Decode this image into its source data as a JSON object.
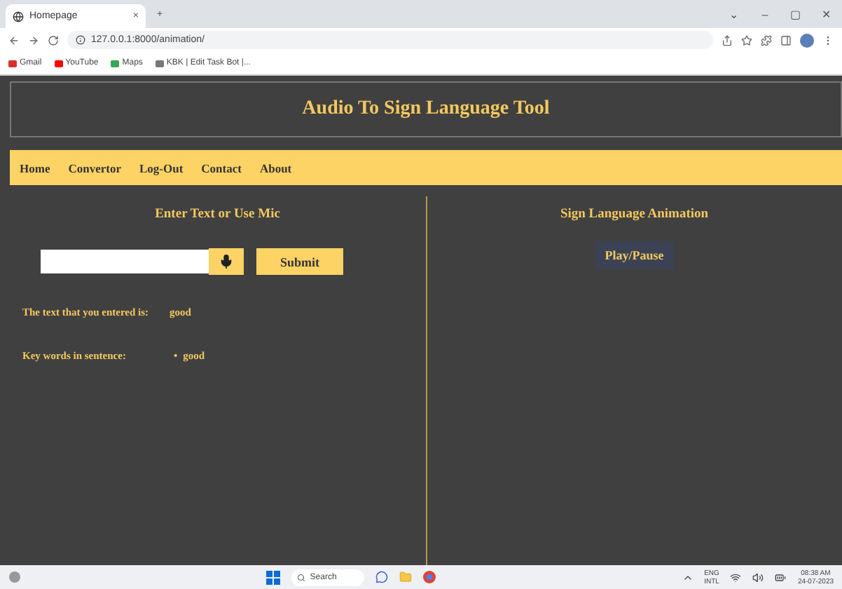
{
  "browser": {
    "tab_title": "Homepage",
    "tab_close": "×",
    "new_tab": "+",
    "url": "127.0.0.1:8000/animation/",
    "window_controls": [
      "⌄",
      "–",
      "▢",
      "✕"
    ],
    "bookmarks": [
      "Gmail",
      "YouTube",
      "Maps",
      "KBK | Edit Task Bot |..."
    ]
  },
  "header": {
    "title": "Audio To Sign Language Tool"
  },
  "nav": [
    "Home",
    "Convertor",
    "Log-Out",
    "Contact",
    "About"
  ],
  "left": {
    "heading": "Enter Text or Use Mic",
    "submit": "Submit",
    "entered_label": "The text that you entered is:",
    "entered_value": "good",
    "keywords_label": "Key words in sentence:",
    "keywords": [
      {
        "bullet": "•",
        "text": "good"
      }
    ]
  },
  "right": {
    "heading": "Sign Language Animation",
    "play": "Play/Pause"
  },
  "taskbar": {
    "search": "Search",
    "lang": "ENG",
    "layout": "INTL",
    "time": "08:38 AM",
    "date": "24-07-2023"
  }
}
